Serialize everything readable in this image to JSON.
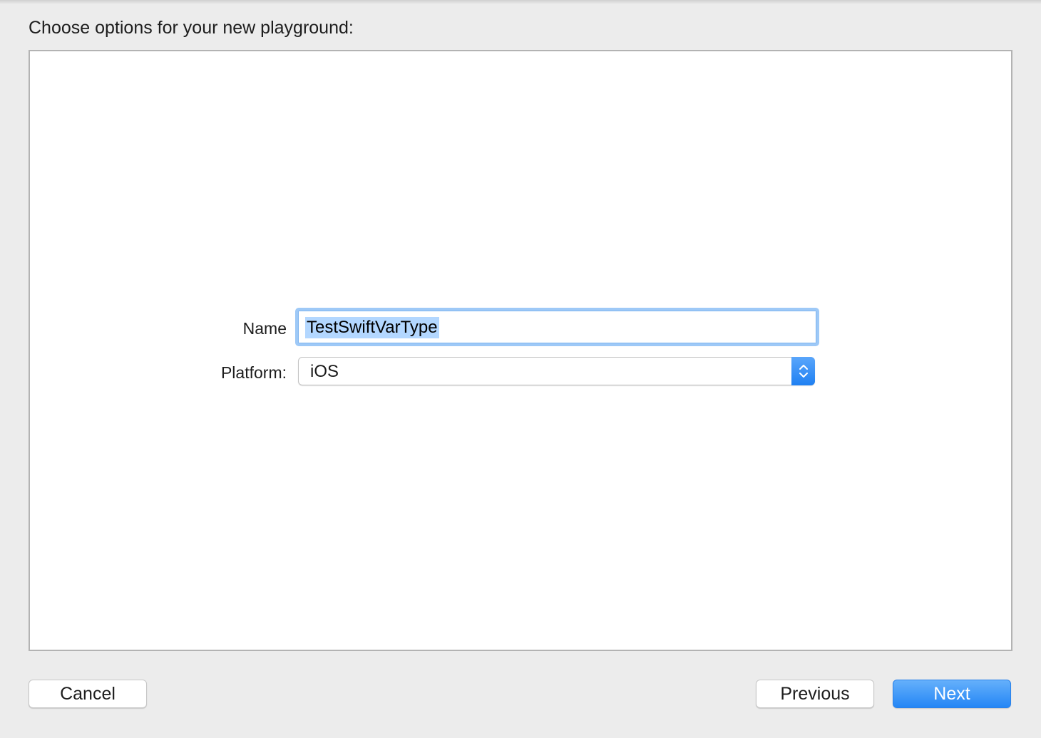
{
  "sheet": {
    "title": "Choose options for your new playground:"
  },
  "form": {
    "name_label": "Name",
    "name_value": "TestSwiftVarType",
    "platform_label": "Platform:",
    "platform_value": "iOS"
  },
  "buttons": {
    "cancel": "Cancel",
    "previous": "Previous",
    "next": "Next"
  },
  "colors": {
    "accent": "#2486f5",
    "focus_ring": "#9ec9f7",
    "selection": "#b3d7ff"
  },
  "icons": {
    "platform_stepper": "up-down-chevron-icon"
  }
}
